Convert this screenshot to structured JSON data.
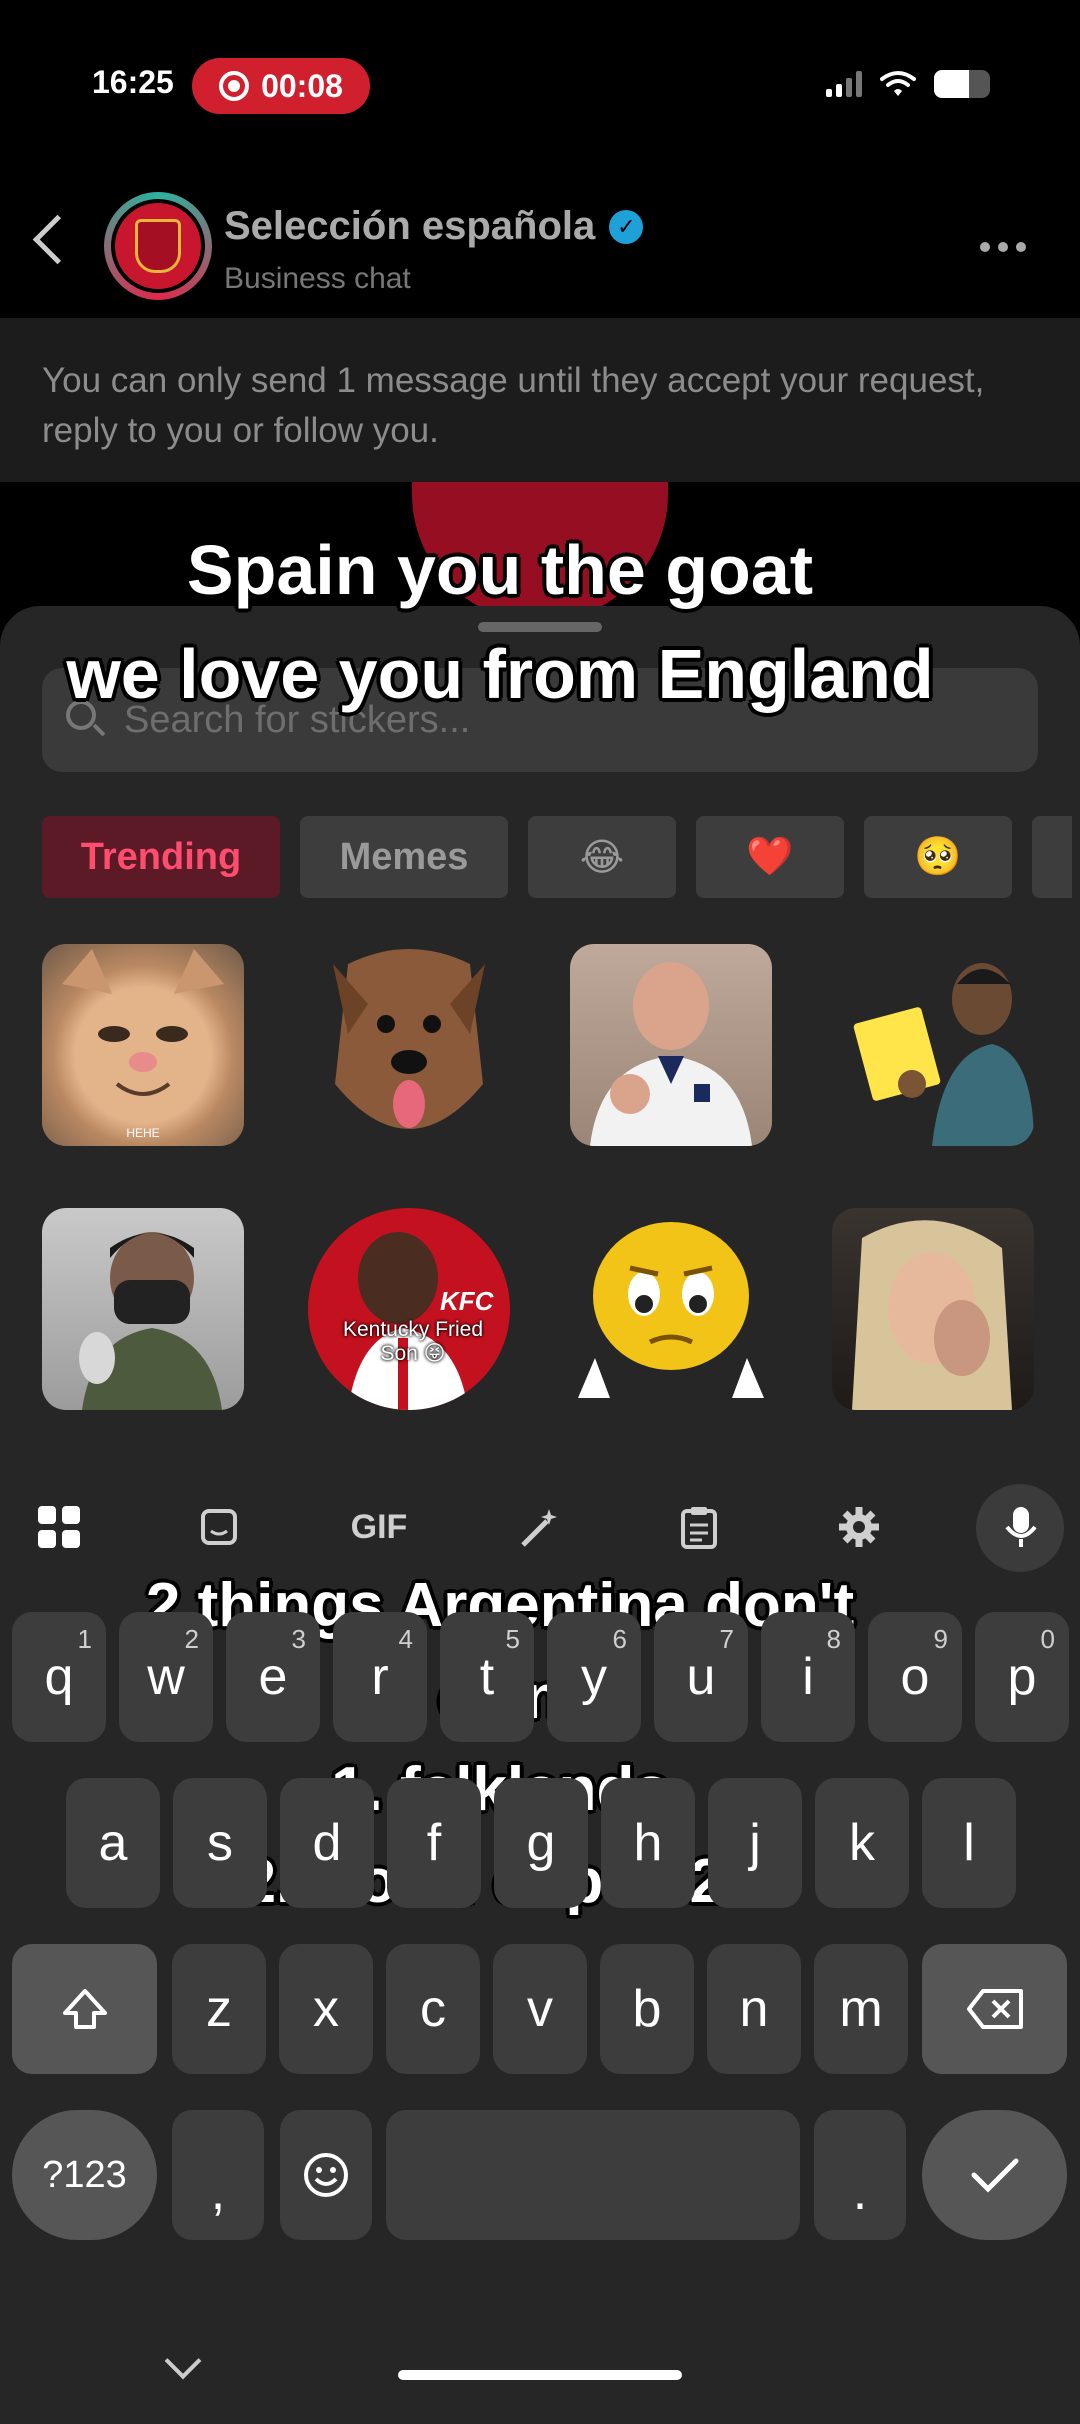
{
  "status_bar": {
    "time": "16:25",
    "recording_time": "00:08"
  },
  "chat_header": {
    "name": "Selección española",
    "subtitle": "Business chat"
  },
  "notice": "You can only send 1 message until they accept your request, reply to you or follow you.",
  "sticker_panel": {
    "search_placeholder": "Search for stickers...",
    "chips": [
      "Trending",
      "Memes",
      "😂",
      "❤️",
      "🥺"
    ],
    "stickers": [
      {
        "name": "cat-sticker",
        "label": "HEHE"
      },
      {
        "name": "dog-sticker",
        "label": ""
      },
      {
        "name": "man-england-shirt-sticker",
        "label": ""
      },
      {
        "name": "man-reading-sticker",
        "label": ""
      },
      {
        "name": "masked-man-sticker",
        "label": ""
      },
      {
        "name": "kfc-sticker",
        "label": "Kentucky Fried Son 😝",
        "badge": "KFC"
      },
      {
        "name": "sad-emoji-sticker",
        "label": ""
      },
      {
        "name": "praying-woman-sticker",
        "label": ""
      }
    ]
  },
  "captions": {
    "top_line1": "Spain you the goat",
    "top_line2": "we love you from England",
    "bottom_line1": "2 things Argentina don't",
    "bottom_line2": "own",
    "bottom_line3": "1. falklands",
    "bottom_line4": "2. world cup 2026"
  },
  "keyboard": {
    "toolbar": {
      "gif": "GIF"
    },
    "row1": [
      {
        "k": "q",
        "n": "1"
      },
      {
        "k": "w",
        "n": "2"
      },
      {
        "k": "e",
        "n": "3"
      },
      {
        "k": "r",
        "n": "4"
      },
      {
        "k": "t",
        "n": "5"
      },
      {
        "k": "y",
        "n": "6"
      },
      {
        "k": "u",
        "n": "7"
      },
      {
        "k": "i",
        "n": "8"
      },
      {
        "k": "o",
        "n": "9"
      },
      {
        "k": "p",
        "n": "0"
      }
    ],
    "row2": [
      "a",
      "s",
      "d",
      "f",
      "g",
      "h",
      "j",
      "k",
      "l"
    ],
    "row3": [
      "z",
      "x",
      "c",
      "v",
      "b",
      "n",
      "m"
    ],
    "symbols": "?123",
    "comma": ",",
    "period": "."
  }
}
